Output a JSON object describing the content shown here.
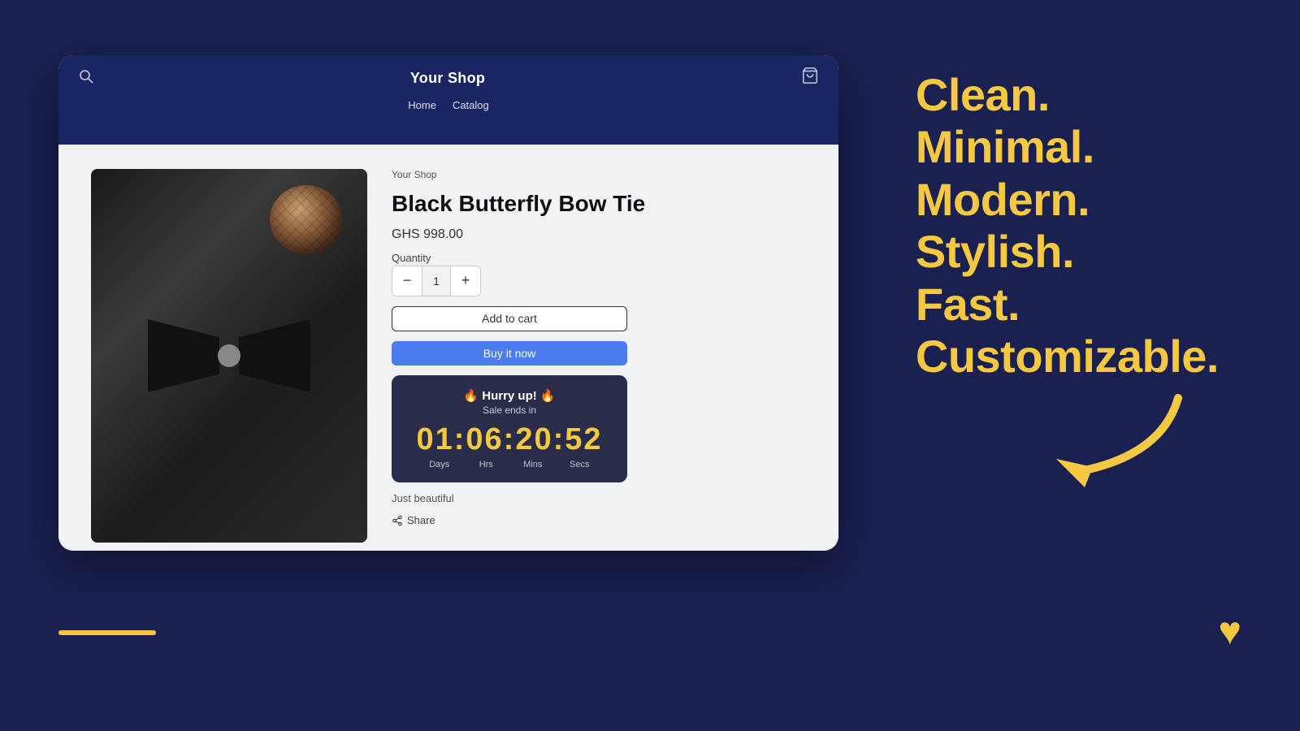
{
  "page": {
    "background_color": "#1a2151"
  },
  "browser": {
    "title": "Your Shop",
    "nav_links": [
      "Home",
      "Catalog"
    ],
    "search_icon": "🔍",
    "cart_icon": "🛍"
  },
  "product": {
    "breadcrumb": "Your Shop",
    "name": "Black Butterfly Bow Tie",
    "price": "GHS 998.00",
    "quantity_label": "Quantity",
    "quantity_value": "1",
    "qty_minus": "−",
    "qty_plus": "+",
    "btn_add_to_cart": "Add to cart",
    "btn_buy_now": "Buy it now",
    "description": "Just beautiful",
    "share_label": "Share"
  },
  "countdown": {
    "title": "🔥 Hurry up! 🔥",
    "subtitle": "Sale ends in",
    "time": "01:06:20:52",
    "labels": [
      "Days",
      "Hrs",
      "Mins",
      "Secs"
    ]
  },
  "tagline": {
    "lines": [
      "Clean.",
      "Minimal.",
      "Modern.",
      "Stylish.",
      "Fast.",
      "Customizable."
    ]
  },
  "decorations": {
    "bottom_line_color": "#f5c842",
    "heart_color": "#f5c842",
    "heart_char": "♥"
  }
}
